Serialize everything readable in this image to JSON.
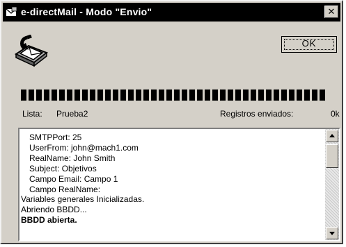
{
  "window": {
    "title": "e-directMail - Modo \"Envio\"",
    "close_label": "✕"
  },
  "buttons": {
    "ok_label": "OK"
  },
  "progress": {
    "fraction": 1.0
  },
  "status": {
    "list_label": "Lista:",
    "list_value": "Prueba2",
    "sent_label": "Registros enviados:",
    "sent_value": "0k"
  },
  "log": {
    "lines": [
      "SMTPPort: 25",
      "UserFrom: john@mach1.com",
      "RealName: John Smith",
      "Subject: Objetivos",
      "Campo Email: Campo 1",
      "Campo RealName:",
      "Variables generales Inicializadas.",
      "Abriendo BBDD...",
      "BBDD abierta."
    ]
  },
  "icons": {
    "app": "app-mail-icon",
    "main": "mail-send-icon"
  }
}
